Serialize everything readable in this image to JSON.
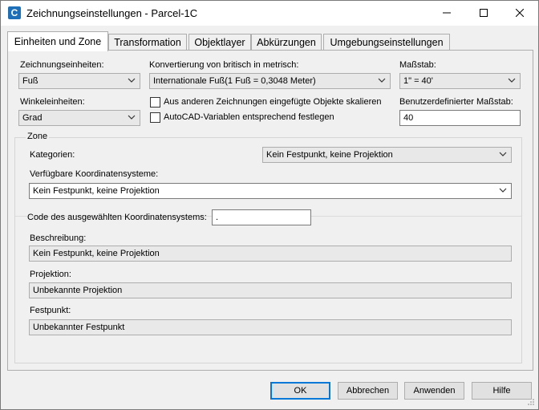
{
  "window": {
    "title": "Zeichnungseinstellungen - Parcel-1C",
    "app_icon_glyph": "C",
    "accent_color": "#0078d7"
  },
  "tabs": [
    {
      "label": "Einheiten und Zone",
      "active": true
    },
    {
      "label": "Transformation",
      "active": false
    },
    {
      "label": "Objektlayer",
      "active": false
    },
    {
      "label": "Abkürzungen",
      "active": false
    },
    {
      "label": "Umgebungseinstellungen",
      "active": false
    }
  ],
  "units": {
    "drawing_units_label": "Zeichnungseinheiten:",
    "drawing_units_value": "Fuß",
    "conversion_label": "Konvertierung von britisch in metrisch:",
    "conversion_value": "Internationale Fuß(1 Fuß = 0,3048 Meter)",
    "scale_label": "Maßstab:",
    "scale_value": "1\" = 40'",
    "angle_units_label": "Winkeleinheiten:",
    "angle_units_value": "Grad",
    "scale_objects_label": "Aus anderen Zeichnungen eingefügte Objekte skalieren",
    "scale_objects_checked": false,
    "autocad_vars_label": "AutoCAD-Variablen entsprechend festlegen",
    "autocad_vars_checked": false,
    "custom_scale_label": "Benutzerdefinierter Maßstab:",
    "custom_scale_value": "40"
  },
  "zone": {
    "group_title": "Zone",
    "categories_label": "Kategorien:",
    "categories_value": "Kein Festpunkt, keine Projektion",
    "available_cs_label": "Verfügbare Koordinatensysteme:",
    "available_cs_value": "Kein Festpunkt, keine Projektion",
    "cs_code_label": "Code des ausgewählten Koordinatensystems:",
    "cs_code_value": ".",
    "description_label": "Beschreibung:",
    "description_value": "Kein Festpunkt, keine Projektion",
    "projection_label": "Projektion:",
    "projection_value": "Unbekannte Projektion",
    "datum_label": "Festpunkt:",
    "datum_value": "Unbekannter Festpunkt"
  },
  "buttons": {
    "ok": "OK",
    "cancel": "Abbrechen",
    "apply": "Anwenden",
    "help": "Hilfe"
  }
}
